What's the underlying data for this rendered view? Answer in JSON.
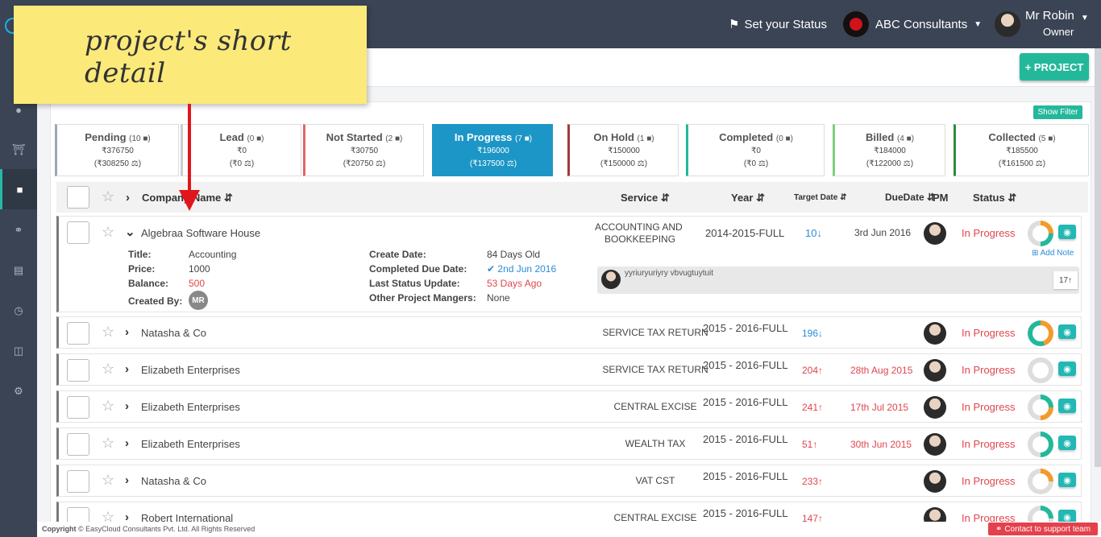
{
  "header": {
    "status_label": "Set your Status",
    "company": "ABC Consultants",
    "user_name": "Mr Robin",
    "user_role": "Owner"
  },
  "annotation": {
    "note_text": "project's short detail"
  },
  "toolbar": {
    "project_button": "+ PROJECT",
    "show_filter": "Show Filter"
  },
  "status_cards": [
    {
      "label": "Pending",
      "count": "(10",
      "amount": "₹376750",
      "balance": "(₹308250 ⚖)",
      "color": "#9aa6b8"
    },
    {
      "label": "Lead",
      "count": "(0",
      "amount": "₹0",
      "balance": "(₹0 ⚖)",
      "color": "#cccccc"
    },
    {
      "label": "Not Started",
      "count": "(2",
      "amount": "₹30750",
      "balance": "(₹20750 ⚖)",
      "color": "#e06666"
    },
    {
      "label": "In Progress",
      "count": "(7",
      "amount": "₹196000",
      "balance": "(₹137500 ⚖)",
      "color": "#1c96c6"
    },
    {
      "label": "On Hold",
      "count": "(1",
      "amount": "₹150000",
      "balance": "(₹150000 ⚖)",
      "color": "#a33a3a"
    },
    {
      "label": "Completed",
      "count": "(0",
      "amount": "₹0",
      "balance": "(₹0 ⚖)",
      "color": "#24b89b"
    },
    {
      "label": "Billed",
      "count": "(4",
      "amount": "₹184000",
      "balance": "(₹122000 ⚖)",
      "color": "#7cd07c"
    },
    {
      "label": "Collected",
      "count": "(5",
      "amount": "₹185500",
      "balance": "(₹161500 ⚖)",
      "color": "#2e8b3e"
    }
  ],
  "table": {
    "headers": {
      "company": "Company Name",
      "service": "Service",
      "year": "Year",
      "target_date": "Target Date",
      "due_date": "DueDate",
      "pm": "PM",
      "status": "Status"
    },
    "expanded": {
      "company": "Algebraa Software House",
      "service_line1": "ACCOUNTING AND",
      "service_line2": "BOOKKEEPING",
      "year": "2014-2015-FULL",
      "target": "10",
      "due": "3rd Jun 2016",
      "status": "In Progress",
      "add_note": "Add Note",
      "note_text": "yyriuryuriyry vbvugtuytuit",
      "note_count": "17",
      "details": {
        "title_label": "Title:",
        "title_value": "Accounting",
        "price_label": "Price:",
        "price_value": "1000",
        "balance_label": "Balance:",
        "balance_value": "500",
        "created_by_label": "Created By:",
        "created_by_value": "MR",
        "create_date_label": "Create Date:",
        "create_date_value": "84 Days Old",
        "completed_due_label": "Completed Due Date:",
        "completed_due_value": "2nd Jun 2016",
        "last_status_label": "Last Status Update:",
        "last_status_value": "53 Days Ago",
        "other_pm_label": "Other Project Mangers:",
        "other_pm_value": "None"
      }
    },
    "rows": [
      {
        "company": "Natasha & Co",
        "service": "SERVICE TAX RETURN",
        "year": "2015 - 2016-FULL",
        "target": "196",
        "due": "",
        "status": "In Progress"
      },
      {
        "company": "Elizabeth Enterprises",
        "service": "SERVICE TAX RETURN",
        "year": "2015 - 2016-FULL",
        "target": "204",
        "due": "28th Aug 2015",
        "status": "In Progress"
      },
      {
        "company": "Elizabeth Enterprises",
        "service": "CENTRAL EXCISE",
        "year": "2015 - 2016-FULL",
        "target": "241",
        "due": "17th Jul 2015",
        "status": "In Progress"
      },
      {
        "company": "Elizabeth Enterprises",
        "service": "WEALTH TAX",
        "year": "2015 - 2016-FULL",
        "target": "51",
        "due": "30th Jun 2015",
        "status": "In Progress"
      },
      {
        "company": "Natasha & Co",
        "service": "VAT CST",
        "year": "2015 - 2016-FULL",
        "target": "233",
        "due": "",
        "status": "In Progress"
      },
      {
        "company": "Robert International",
        "service": "CENTRAL EXCISE",
        "year": "2015 - 2016-FULL",
        "target": "147",
        "due": "",
        "status": "In Progress"
      }
    ]
  },
  "footer": {
    "copyright_bold": "Copyright",
    "copyright_text": "© EasyCloud Consultants Pvt. Ltd. All Rights Reserved",
    "contact": "Contact to support team"
  }
}
